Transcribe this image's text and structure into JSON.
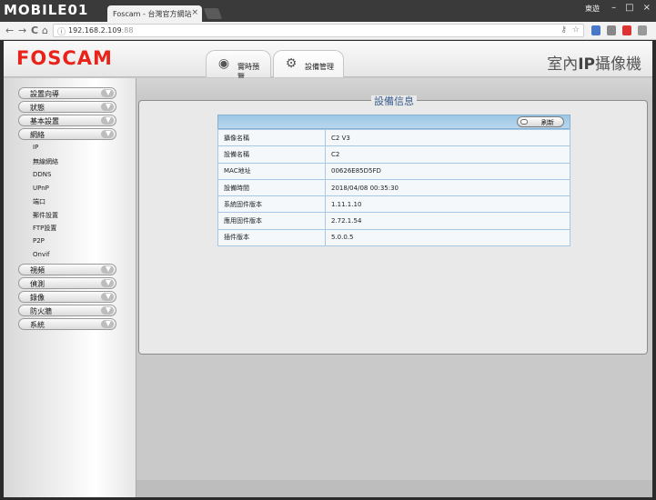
{
  "browser": {
    "site_logo": "MOBILE01",
    "tab_title": "Foscam - 台灣官方網站",
    "tab_close": "×",
    "user": "東遊",
    "url_host": "192.168.2.109",
    "url_port": ":88",
    "nav_back": "←",
    "nav_forward": "→",
    "nav_reload": "C",
    "nav_home": "⌂",
    "info_icon": "ⓘ",
    "win_minimize": "–",
    "win_maximize": "□",
    "win_close": "×"
  },
  "header": {
    "brand": "FOSCAM",
    "tabs": [
      {
        "label": "實時預覽",
        "icon": "webcam-icon"
      },
      {
        "label": "設備管理",
        "icon": "wrench-gear-icon"
      }
    ],
    "product_title_prefix": "室內",
    "product_title_bold": "IP",
    "product_title_suffix": "攝像機"
  },
  "sidebar": {
    "groups_top": [
      "設置向導",
      "狀態",
      "基本設置",
      "網絡"
    ],
    "network_items": [
      "IP",
      "無線網絡",
      "DDNS",
      "UPnP",
      "端口",
      "郵件設置",
      "FTP設置",
      "P2P",
      "Onvif"
    ],
    "groups_bottom": [
      "視頻",
      "偵測",
      "錄像",
      "防火牆",
      "系統"
    ]
  },
  "device_info": {
    "title": "設備信息",
    "refresh_label": "刷新",
    "rows": [
      {
        "key": "攝像名稱",
        "value": "C2 V3"
      },
      {
        "key": "設備名稱",
        "value": "C2"
      },
      {
        "key": "MAC地址",
        "value": "00626E85D5FD"
      },
      {
        "key": "設備時間",
        "value": "2018/04/08 00:35:30"
      },
      {
        "key": "系統固件版本",
        "value": "1.11.1.10"
      },
      {
        "key": "應用固件版本",
        "value": "2.72.1.54"
      },
      {
        "key": "插件版本",
        "value": "5.0.0.5"
      }
    ]
  },
  "colors": {
    "brand_red": "#e8231a",
    "title_blue": "#3a5e8c",
    "table_header_blue": "#9cc7e6"
  }
}
